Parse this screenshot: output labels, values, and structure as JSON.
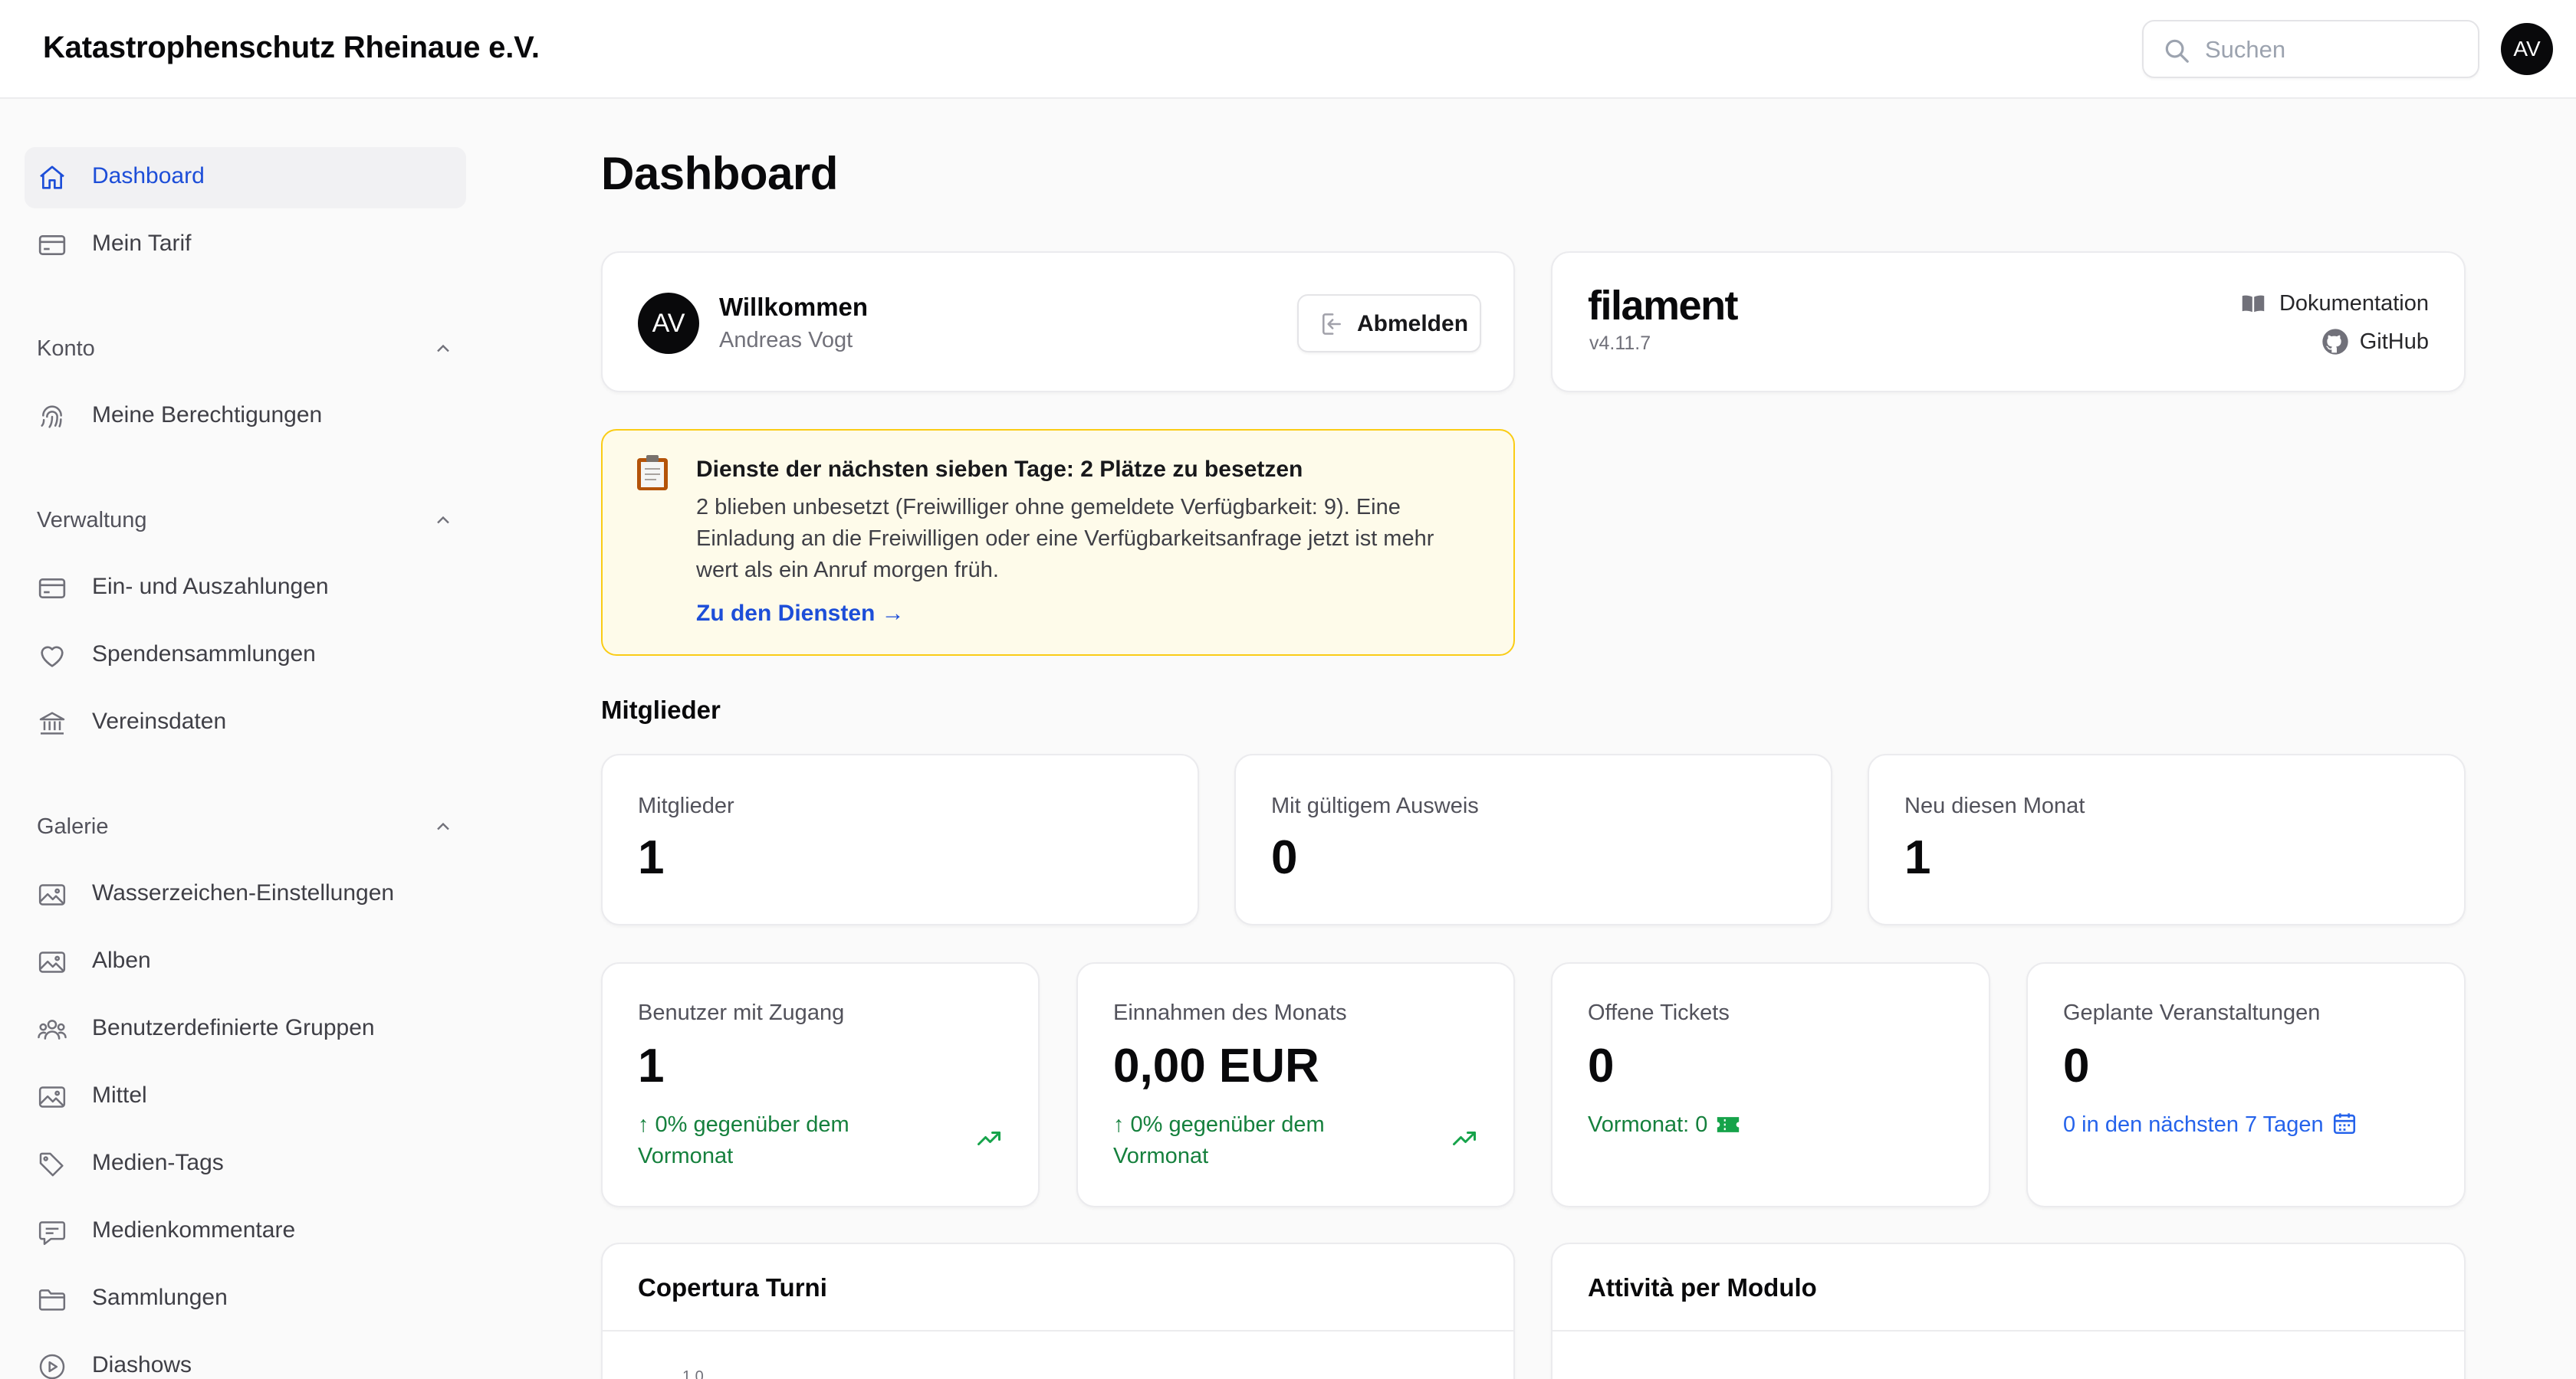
{
  "topbar": {
    "brand": "Katastrophenschutz Rheinaue e.V.",
    "search_placeholder": "Suchen",
    "avatar_initials": "AV"
  },
  "sidebar": {
    "top_items": [
      {
        "label": "Dashboard",
        "icon": "home-icon",
        "active": true
      },
      {
        "label": "Mein Tarif",
        "icon": "credit-card-icon",
        "active": false
      }
    ],
    "groups": [
      {
        "label": "Konto",
        "items": [
          {
            "label": "Meine Berechtigungen",
            "icon": "fingerprint-icon"
          }
        ]
      },
      {
        "label": "Verwaltung",
        "items": [
          {
            "label": "Ein- und Auszahlungen",
            "icon": "credit-card-icon"
          },
          {
            "label": "Spendensammlungen",
            "icon": "heart-icon"
          },
          {
            "label": "Vereinsdaten",
            "icon": "building-library-icon"
          }
        ]
      },
      {
        "label": "Galerie",
        "items": [
          {
            "label": "Wasserzeichen-Einstellungen",
            "icon": "photo-icon"
          },
          {
            "label": "Alben",
            "icon": "photo-icon"
          },
          {
            "label": "Benutzerdefinierte Gruppen",
            "icon": "user-group-icon"
          },
          {
            "label": "Mittel",
            "icon": "photo-icon"
          },
          {
            "label": "Medien-Tags",
            "icon": "tag-icon"
          },
          {
            "label": "Medienkommentare",
            "icon": "chat-bubble-icon"
          },
          {
            "label": "Sammlungen",
            "icon": "folder-icon"
          },
          {
            "label": "Diashows",
            "icon": "play-circle-icon"
          }
        ]
      }
    ]
  },
  "main": {
    "title": "Dashboard",
    "welcome": {
      "avatar_initials": "AV",
      "title": "Willkommen",
      "name": "Andreas Vogt",
      "logout_label": "Abmelden"
    },
    "filament": {
      "logo": "filament",
      "version": "v4.11.7",
      "docs_label": "Dokumentation",
      "github_label": "GitHub"
    },
    "alert": {
      "title": "Dienste der nächsten sieben Tage: 2 Plätze zu besetzen",
      "body": "2 blieben unbesetzt (Freiwilliger ohne gemeldete Verfügbarkeit: 9). Eine Einladung an die Freiwilligen oder eine Verfügbarkeitsanfrage jetzt ist mehr wert als ein Anruf morgen früh.",
      "link": "Zu den Diensten →"
    },
    "members_section": "Mitglieder",
    "members_stats": [
      {
        "label": "Mitglieder",
        "value": "1"
      },
      {
        "label": "Mit gültigem Ausweis",
        "value": "0"
      },
      {
        "label": "Neu diesen Monat",
        "value": "1"
      }
    ],
    "stats": [
      {
        "label": "Benutzer mit Zugang",
        "value": "1",
        "description": "↑ 0% gegenüber dem Vormonat",
        "color": "#15803d"
      },
      {
        "label": "Einnahmen des Monats",
        "value": "0,00 EUR",
        "description": "↑ 0% gegenüber dem Vormonat",
        "color": "#15803d"
      },
      {
        "label": "Offene Tickets",
        "value": "0",
        "description": "Vormonat: 0",
        "color": "#15803d"
      },
      {
        "label": "Geplante Veranstaltungen",
        "value": "0",
        "description": "0 in den nächsten 7 Tagen",
        "color": "#2563eb"
      }
    ],
    "charts": [
      {
        "title": "Copertura Turni",
        "first_tick": "1.0"
      },
      {
        "title": "Attività per Modulo"
      }
    ]
  },
  "colors": {
    "accent": "#1d4ed8",
    "success": "#15803d",
    "info": "#2563eb",
    "alert_bg": "#fefbea",
    "alert_border": "#facc15"
  }
}
